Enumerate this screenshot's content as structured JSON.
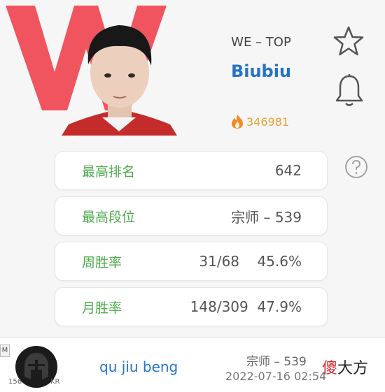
{
  "profile": {
    "team_position": "WE – TOP",
    "player_name": "Biubiu",
    "heat_value": "346981"
  },
  "stats": [
    {
      "label": "最高排名",
      "value": "642"
    },
    {
      "label": "最高段位",
      "value": "宗师 – 539"
    },
    {
      "label": "周胜率",
      "value": "31/68    45.6%"
    },
    {
      "label": "月胜率",
      "value": "148/309  47.9%"
    }
  ],
  "match_row": {
    "badge": "M",
    "level": "156",
    "region": "KR",
    "summoner": "qu jiu beng",
    "rank": "宗师 – 539",
    "time": "2022-07-16 02:54"
  },
  "watermark": {
    "first": "傻",
    "rest": "大方"
  },
  "colors": {
    "logo_red": "#f0545e",
    "name_blue": "#2573c7",
    "label_green": "#4caa4c",
    "heat_orange": "#e5a234"
  },
  "icons": [
    "we-logo",
    "star-icon",
    "bell-icon",
    "help-icon",
    "flame-icon",
    "helmet-icon"
  ]
}
